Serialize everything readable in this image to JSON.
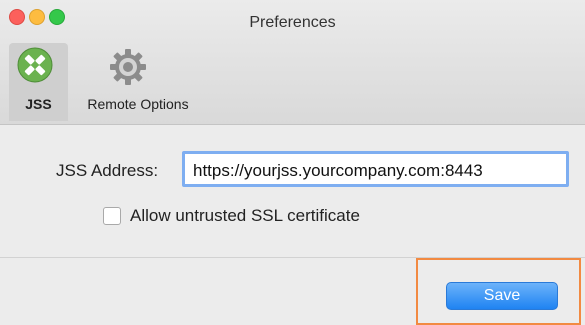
{
  "window": {
    "title": "Preferences"
  },
  "toolbar": {
    "items": [
      {
        "label": "JSS",
        "icon": "jss-logo-icon",
        "selected": true
      },
      {
        "label": "Remote Options",
        "icon": "gear-icon",
        "selected": false
      }
    ]
  },
  "form": {
    "address_label": "JSS Address:",
    "address_value": "https://yourjss.yourcompany.com:8443",
    "checkbox_label": "Allow untrusted SSL certificate",
    "checkbox_checked": false
  },
  "footer": {
    "save_label": "Save"
  },
  "colors": {
    "accent": "#1f83f2",
    "highlight": "#f28a42",
    "jss_logo": "#62a94a"
  }
}
